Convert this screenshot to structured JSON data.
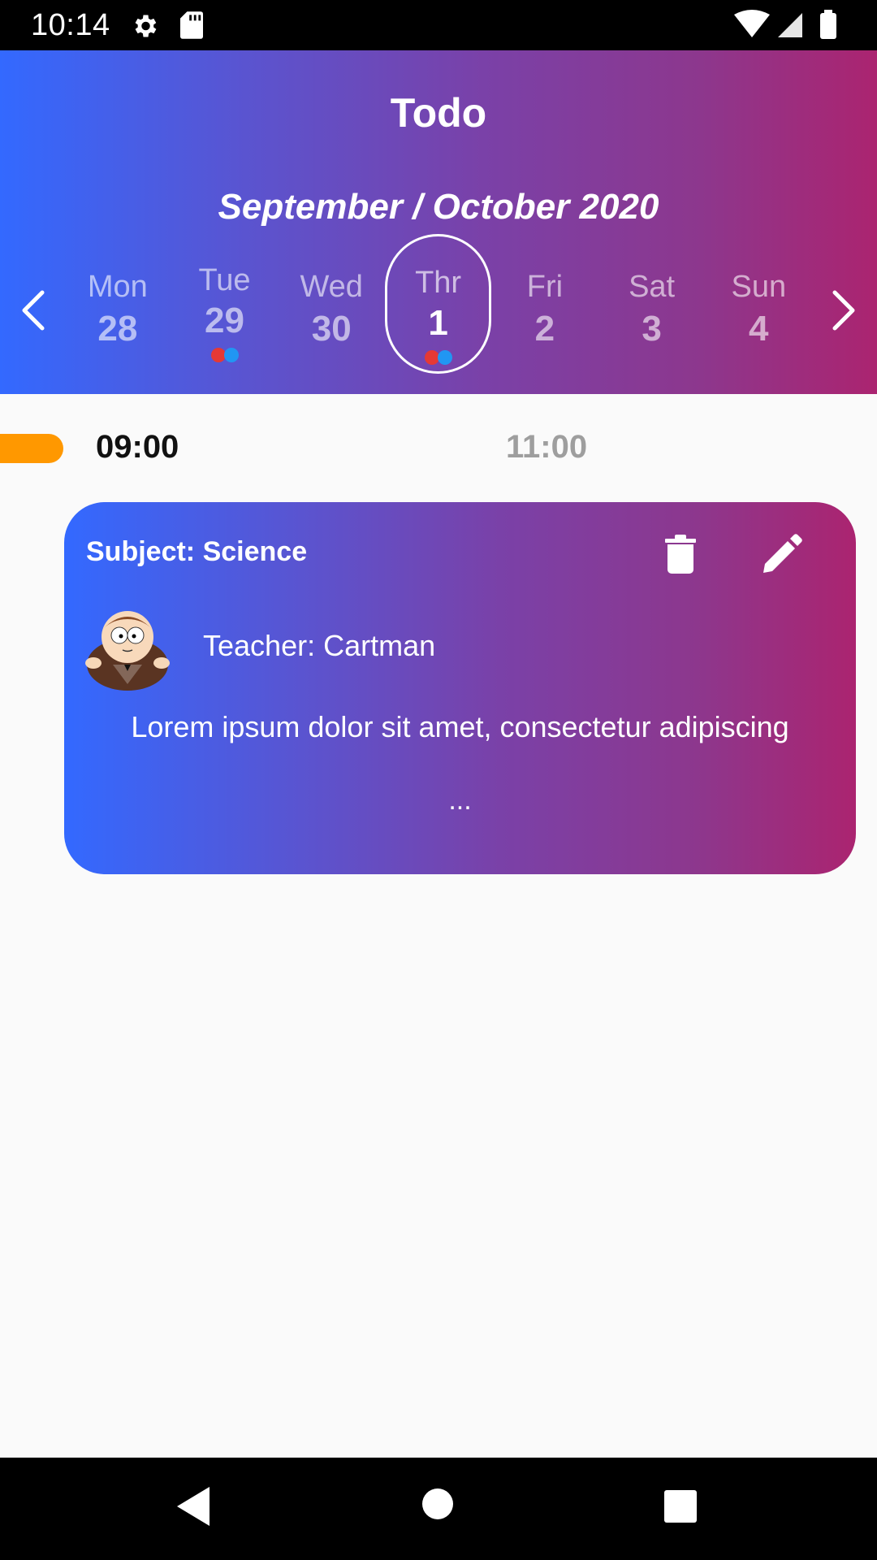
{
  "status_bar": {
    "time": "10:14",
    "icons": [
      "gear-icon",
      "sd-card-icon",
      "wifi-icon",
      "signal-icon",
      "battery-icon"
    ]
  },
  "header": {
    "title": "Todo",
    "month_label": "September  / October 2020",
    "prev_icon": "chevron-left-icon",
    "next_icon": "chevron-right-icon",
    "days": [
      {
        "name": "Mon",
        "number": "28"
      },
      {
        "name": "Tue",
        "number": "29"
      },
      {
        "name": "Wed",
        "number": "30"
      },
      {
        "name": "Thr",
        "number": "1"
      },
      {
        "name": "Fri",
        "number": "2"
      },
      {
        "name": "Sat",
        "number": "3"
      },
      {
        "name": "Sun",
        "number": "4"
      }
    ],
    "selected_day_index": 3,
    "days_with_events": [
      1,
      3
    ]
  },
  "timeline": {
    "start_time": "09:00",
    "end_time": "11:00"
  },
  "card": {
    "subject": "Subject: Science",
    "teacher": "Teacher: Cartman",
    "description": "Lorem ipsum dolor sit amet, consectetur adipiscing",
    "more": "...",
    "delete_icon": "trash-icon",
    "edit_icon": "pencil-icon"
  },
  "colors": {
    "gradient_start": "#3369ff",
    "gradient_end": "#ab2470",
    "time_marker": "#ff9800",
    "dot_red": "#e53935",
    "dot_blue": "#2196f3"
  }
}
